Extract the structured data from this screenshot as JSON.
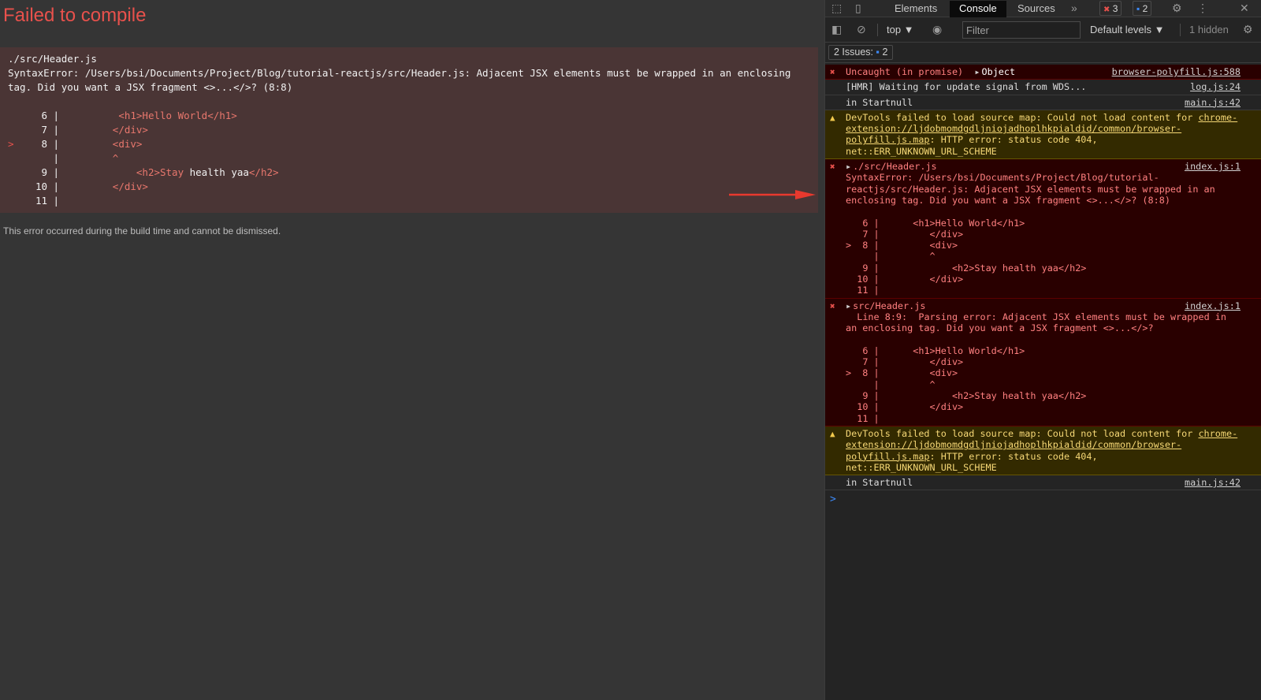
{
  "overlay": {
    "title": "Failed to compile",
    "file": "./src/Header.js",
    "message": "SyntaxError: /Users/bsi/Documents/Project/Blog/tutorial-reactjs/src/Header.js: Adjacent JSX elements must be wrapped in an enclosing tag. Did you want a JSX fragment <>...</>? (8:8)",
    "code_lines": [
      {
        "num": "6",
        "marker": "",
        "tag_before": " <h1>Hello World</h1>",
        "text": "",
        "tag_after": ""
      },
      {
        "num": "7",
        "marker": "",
        "tag_before": "</div>",
        "text": "",
        "tag_after": ""
      },
      {
        "num": "8",
        "marker": ">",
        "tag_before": "<div>",
        "text": "",
        "tag_after": ""
      },
      {
        "num": "",
        "marker": "",
        "tag_before": "^",
        "text": "",
        "tag_after": ""
      },
      {
        "num": "9",
        "marker": "",
        "tag_before": "    <h2>Stay",
        "text": " health yaa",
        "tag_after": "</h2>"
      },
      {
        "num": "10",
        "marker": "",
        "tag_before": "</div>",
        "text": "",
        "tag_after": ""
      },
      {
        "num": "11",
        "marker": "",
        "tag_before": "",
        "text": "",
        "tag_after": ""
      }
    ],
    "build_note": "This error occurred during the build time and cannot be dismissed."
  },
  "devtools": {
    "tabs": [
      "Elements",
      "Console",
      "Sources"
    ],
    "active_tab": "Console",
    "more_tabs": "»",
    "error_count": "3",
    "info_count": "2",
    "toolbar": {
      "context": "top ▼",
      "filter_placeholder": "Filter",
      "levels": "Default levels ▼",
      "hidden": "1 hidden"
    },
    "issues_label": "2 Issues:",
    "issues_count": "2",
    "messages": [
      {
        "kind": "error",
        "caret": false,
        "body": "Uncaught (in promise)",
        "object": "Object",
        "source": "browser-polyfill.js:588"
      },
      {
        "kind": "log",
        "body": "[HMR] Waiting for update signal from WDS...",
        "source": "log.js:24"
      },
      {
        "kind": "log",
        "body": "in Startnull",
        "source": "main.js:42"
      },
      {
        "kind": "warn",
        "body_pre": "DevTools failed to load source map: Could not load content for ",
        "link": "chrome-extension://ljdobmomdgdljniojadhoplhkpialdid/common/browser-polyfill.js.map",
        "body_post": ": HTTP error: status code 404, net::ERR_UNKNOWN_URL_SCHEME",
        "source": ""
      },
      {
        "kind": "error",
        "caret": true,
        "body": "./src/Header.js\nSyntaxError: /Users/bsi/Documents/Project/Blog/tutorial-reactjs/src/Header.js: Adjacent JSX elements must be wrapped in an enclosing tag. Did you want a JSX fragment <>...</>? (8:8)\n\n   6 |      <h1>Hello World</h1>\n   7 |         </div>\n>  8 |         <div>\n     |         ^\n   9 |             <h2>Stay health yaa</h2>\n  10 |         </div>\n  11 |",
        "source": "index.js:1"
      },
      {
        "kind": "error",
        "caret": true,
        "body": "src/Header.js\n  Line 8:9:  Parsing error: Adjacent JSX elements must be wrapped in an enclosing tag. Did you want a JSX fragment <>...</>?\n\n   6 |      <h1>Hello World</h1>\n   7 |         </div>\n>  8 |         <div>\n     |         ^\n   9 |             <h2>Stay health yaa</h2>\n  10 |         </div>\n  11 |",
        "source": "index.js:1"
      },
      {
        "kind": "warn",
        "body_pre": "DevTools failed to load source map: Could not load content for ",
        "link": "chrome-extension://ljdobmomdgdljniojadhoplhkpialdid/common/browser-polyfill.js.map",
        "body_post": ": HTTP error: status code 404, net::ERR_UNKNOWN_URL_SCHEME",
        "source": ""
      },
      {
        "kind": "log",
        "body": "in Startnull",
        "source": "main.js:42"
      }
    ],
    "prompt_symbol": ">"
  }
}
